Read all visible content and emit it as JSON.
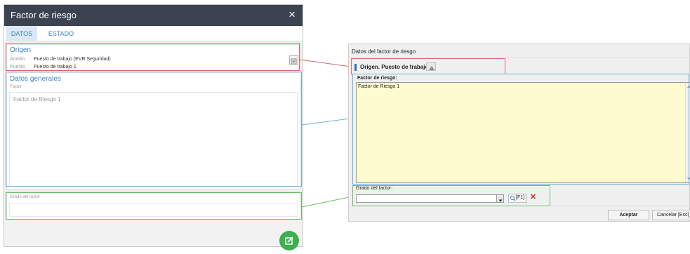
{
  "left": {
    "title": "Factor de riesgo",
    "close_glyph": "×",
    "tabs": [
      {
        "label": "DATOS"
      },
      {
        "label": "ESTADO"
      }
    ],
    "origen": {
      "title": "Origen",
      "ambito_key": "Ámbito",
      "ambito_value": "Puesto de trabajo (EVR Seguridad)",
      "puesto_key": "Puesto",
      "puesto_value": "Puesto de trabajo 1"
    },
    "datos": {
      "title": "Datos generales",
      "factor_label": "Factor",
      "factor_value": "Factor de Riesgo 1"
    },
    "grado": {
      "label": "Grado del factor",
      "value": ""
    },
    "fab_icon": "edit-icon"
  },
  "right": {
    "title": "Datos del factor de riesgo",
    "origen_label": "Origen. Puesto de trabajo",
    "factor_label": "Factor de riesgo:",
    "factor_value": "Factor de Riesgo 1",
    "grado_label": "Grado del factor:",
    "f1_label": "[F1]",
    "aceptar_label": "Aceptar",
    "cancelar_label": "Cancelar [Esc]"
  },
  "colors": {
    "header_bg": "#3b4350",
    "accent_blue": "#3d85c6",
    "fab_green": "#3fae4f",
    "highlight_red": "#e06666",
    "highlight_blue": "#6fb3d2",
    "highlight_green": "#6abf6a",
    "textarea_yellow": "#fffbd0"
  }
}
